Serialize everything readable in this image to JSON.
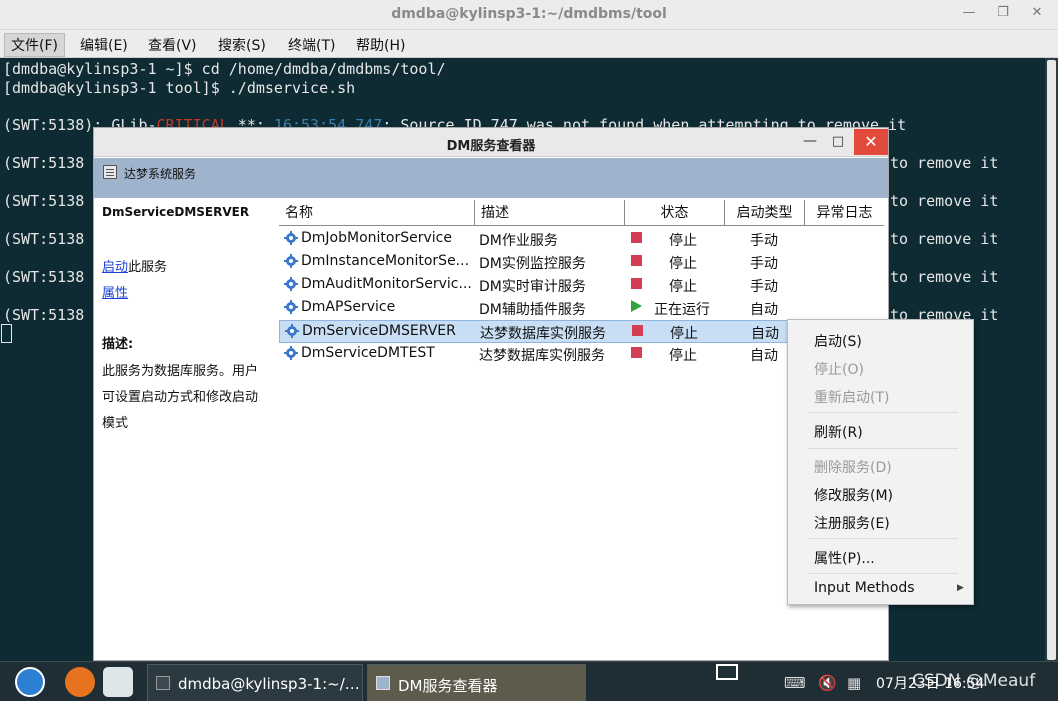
{
  "terminal": {
    "title": "dmdba@kylinsp3-1:~/dmdbms/tool",
    "menu": [
      "文件(F)",
      "编辑(E)",
      "查看(V)",
      "搜索(S)",
      "终端(T)",
      "帮助(H)"
    ],
    "lines": [
      "[dmdba@kylinsp3-1 ~]$ cd /home/dmdba/dmdbms/tool/",
      "[dmdba@kylinsp3-1 tool]$ ./dmservice.sh"
    ],
    "swt_prefix": "(SWT:5138",
    "swt_mid1": "): GLib-",
    "swt_critical": "CRITICAL",
    "swt_mid2": " **: ",
    "swt_time": "16:53:54.747",
    "swt_rest": ": Source ID 747 was not found when attempting to remove it",
    "swt_tail": "to remove it"
  },
  "dialog": {
    "title": "DM服务查看器",
    "toolbar_label": "达梦系统服务",
    "selected_service": "DmServiceDMSERVER",
    "start_link": "启动",
    "start_suffix": "此服务",
    "properties_link": "属性",
    "desc_label": "描述:",
    "desc_lines": [
      "此服务为数据库服务。用户",
      "可设置启动方式和修改启动",
      "模式"
    ],
    "columns": [
      "名称",
      "描述",
      "状态",
      "启动类型",
      "异常日志"
    ],
    "rows": [
      {
        "name": "DmJobMonitorService",
        "desc": "DM作业服务",
        "status": "停止",
        "start_type": "手动",
        "running": false
      },
      {
        "name": "DmInstanceMonitorSe...",
        "desc": "DM实例监控服务",
        "status": "停止",
        "start_type": "手动",
        "running": false
      },
      {
        "name": "DmAuditMonitorServic...",
        "desc": "DM实时审计服务",
        "status": "停止",
        "start_type": "手动",
        "running": false
      },
      {
        "name": "DmAPService",
        "desc": "DM辅助插件服务",
        "status": "正在运行",
        "start_type": "自动",
        "running": true
      },
      {
        "name": "DmServiceDMSERVER",
        "desc": "达梦数据库实例服务",
        "status": "停止",
        "start_type": "自动",
        "running": false
      },
      {
        "name": "DmServiceDMTEST",
        "desc": "达梦数据库实例服务",
        "status": "停止",
        "start_type": "自动",
        "running": false
      }
    ]
  },
  "context_menu": {
    "start": "启动(S)",
    "stop": "停止(O)",
    "restart": "重新启动(T)",
    "refresh": "刷新(R)",
    "delete": "删除服务(D)",
    "modify": "修改服务(M)",
    "register": "注册服务(E)",
    "properties": "属性(P)...",
    "input_methods": "Input Methods"
  },
  "taskbar": {
    "task_terminal": "dmdba@kylinsp3-1:~/…",
    "task_viewer": "DM服务查看器",
    "clock": "07月23日 16:54",
    "watermark": "CSDN @Meauf"
  },
  "colors": {
    "terminal_bg": "#0e2a33",
    "toolbar_bg": "#9fb3cc",
    "stop_red": "#d23f54",
    "run_green": "#2fa53c",
    "close_red": "#e24b3b",
    "selection": "#c8def5"
  }
}
